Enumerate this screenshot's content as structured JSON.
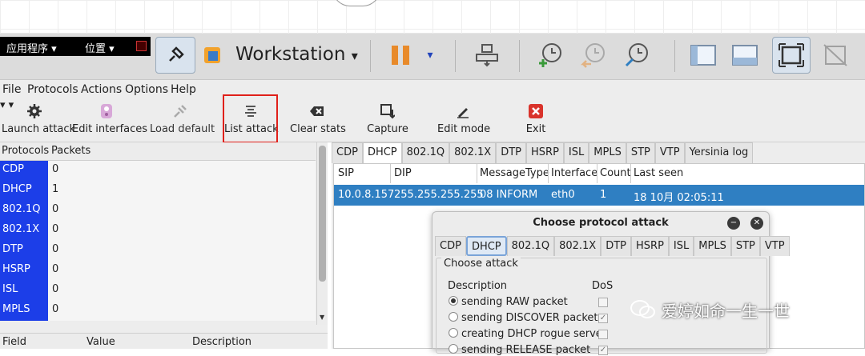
{
  "gnome": {
    "apps": "应用程序 ▾",
    "places": "位置 ▾"
  },
  "vmware": {
    "title": "Workstation",
    "dropdown": "▾",
    "pause_dropdown": "▾"
  },
  "menu": {
    "file": "File",
    "protocols": "Protocols",
    "actions": "Actions",
    "options": "Options",
    "help": "Help"
  },
  "toolbar": {
    "launch": "Launch attack",
    "edit_interfaces": "Edit interfaces",
    "load_default": "Load default",
    "list_attack": "List attack",
    "clear_stats": "Clear stats",
    "capture": "Capture",
    "edit_mode": "Edit mode",
    "exit": "Exit",
    "dd": "▾"
  },
  "protocols_table": {
    "headers": [
      "Protocols",
      "Packets"
    ],
    "rows": [
      {
        "name": "CDP",
        "packets": "0"
      },
      {
        "name": "DHCP",
        "packets": "1"
      },
      {
        "name": "802.1Q",
        "packets": "0"
      },
      {
        "name": "802.1X",
        "packets": "0"
      },
      {
        "name": "DTP",
        "packets": "0"
      },
      {
        "name": "HSRP",
        "packets": "0"
      },
      {
        "name": "ISL",
        "packets": "0"
      },
      {
        "name": "MPLS",
        "packets": "0"
      }
    ]
  },
  "fields_table": {
    "headers": [
      "Field",
      "Value",
      "Description"
    ]
  },
  "tabs": [
    "CDP",
    "DHCP",
    "802.1Q",
    "802.1X",
    "DTP",
    "HSRP",
    "ISL",
    "MPLS",
    "STP",
    "VTP",
    "Yersinia log"
  ],
  "dhcp_table": {
    "headers": [
      "SIP",
      "DIP",
      "MessageType",
      "Interface",
      "Count",
      "Last seen"
    ],
    "row": {
      "sip": "10.0.8.157",
      "dip": "255.255.255.255",
      "type": "08 INFORM",
      "iface": "eth0",
      "count": "1",
      "last": "18 10月 02:05:11"
    }
  },
  "dialog": {
    "title": "Choose protocol attack",
    "tabs": [
      "CDP",
      "DHCP",
      "802.1Q",
      "802.1X",
      "DTP",
      "HSRP",
      "ISL",
      "MPLS",
      "STP",
      "VTP"
    ],
    "group": "Choose attack",
    "col_desc": "Description",
    "col_dos": "DoS",
    "options": [
      {
        "label": "sending RAW packet",
        "selected": true,
        "dos": false
      },
      {
        "label": "sending DISCOVER packet",
        "selected": false,
        "dos": true
      },
      {
        "label": "creating DHCP rogue server",
        "selected": false,
        "dos": false
      },
      {
        "label": "sending RELEASE packet",
        "selected": false,
        "dos": true
      }
    ]
  },
  "watermark": "爱婷如命一生一世",
  "colors": {
    "protocol_cell": "#1c3ee8",
    "selected_row": "#2f7fc2",
    "highlight": "#e0201a"
  }
}
